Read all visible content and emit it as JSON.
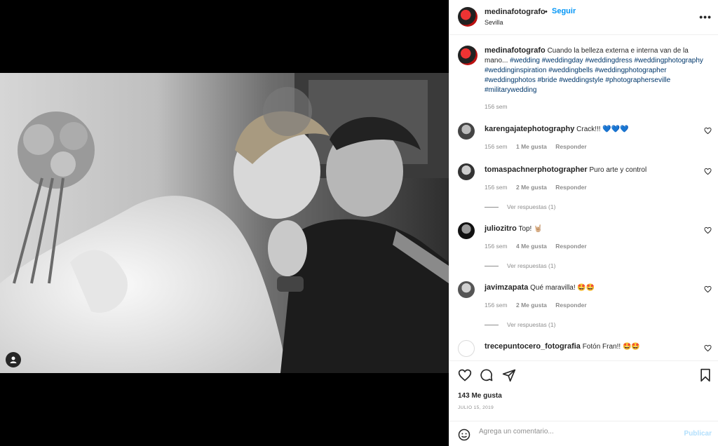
{
  "post": {
    "username": "medinafotografo",
    "follow_label": "Seguir",
    "dot": "•",
    "location": "Sevilla",
    "more": "•••"
  },
  "caption": {
    "username": "medinafotografo",
    "text": "Cuando la belleza externa e interna van de la mano...",
    "hashtags": "#wedding #weddingday #weddingdress #weddingphotography #weddinginspiration #weddingbells #weddingphotographer #weddingphotos #bride #weddingstyle #photographerseville #militarywedding",
    "time": "156 sem"
  },
  "comments": [
    {
      "username": "karengajatephotography",
      "text": "Crack!!! 💙💙💙",
      "time": "156 sem",
      "likes": "1 Me gusta",
      "reply": "Responder",
      "view_replies": ""
    },
    {
      "username": "tomaspachnerphotographer",
      "text": "Puro arte y control",
      "time": "156 sem",
      "likes": "2 Me gusta",
      "reply": "Responder",
      "view_replies": "Ver respuestas (1)"
    },
    {
      "username": "juliozitro",
      "text": "Top! 🤘🏼",
      "time": "156 sem",
      "likes": "4 Me gusta",
      "reply": "Responder",
      "view_replies": "Ver respuestas (1)"
    },
    {
      "username": "javimzapata",
      "text": "Qué maravilla! 🤩🤩",
      "time": "156 sem",
      "likes": "2 Me gusta",
      "reply": "Responder",
      "view_replies": "Ver respuestas (1)"
    },
    {
      "username": "trecepuntocero_fotografia",
      "text": "Fotón Fran!! 🤩🤩",
      "time": "",
      "likes": "",
      "reply": "",
      "view_replies": ""
    }
  ],
  "actions": {
    "likes": "143 Me gusta",
    "date": "JULIO 15, 2019"
  },
  "add_comment": {
    "placeholder": "Agrega un comentario...",
    "publish": "Publicar"
  },
  "icons": {
    "tag": "user-tag-icon",
    "like": "heart-icon",
    "comment": "comment-bubble-icon",
    "share": "paper-plane-icon",
    "save": "bookmark-icon",
    "emoji": "smiley-icon",
    "more": "more-options-icon"
  },
  "colors": {
    "link": "#0095f6",
    "hashtag": "#00376b",
    "muted": "#8e8e8e",
    "heart_blue": "#1877f2"
  }
}
